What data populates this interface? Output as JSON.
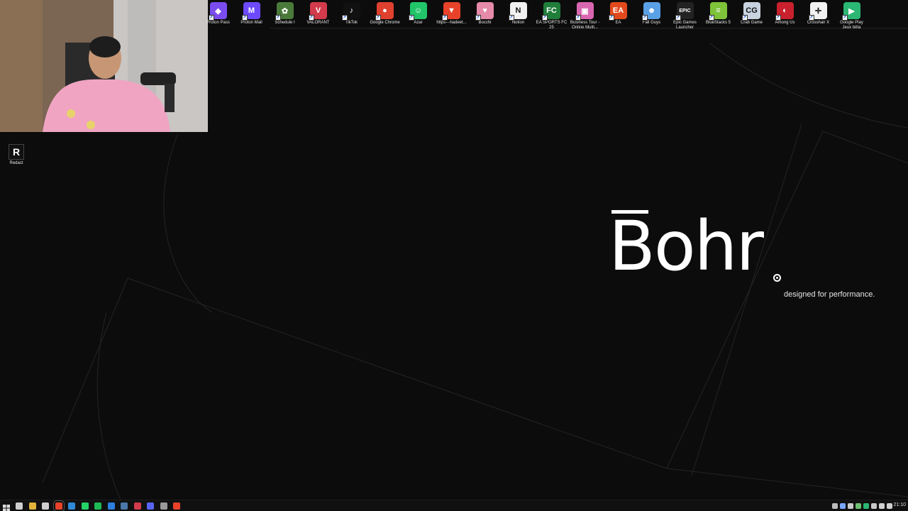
{
  "desktop_icons": [
    {
      "label": "Proton Pass",
      "icon": "proton-pass-icon",
      "color": "#7b4cf0",
      "glyph": "◆"
    },
    {
      "label": "Proton Mail",
      "icon": "proton-mail-icon",
      "color": "#6d4aff",
      "glyph": "M"
    },
    {
      "label": "Schedule I",
      "icon": "schedule-one-icon",
      "color": "#4a7a3a",
      "glyph": "✿"
    },
    {
      "label": "VALORANT",
      "icon": "valorant-icon",
      "color": "#d13b4b",
      "glyph": "V"
    },
    {
      "label": "TikTok",
      "icon": "tiktok-icon",
      "color": "#111111",
      "glyph": "♪"
    },
    {
      "label": "Google Chrome",
      "icon": "chrome-icon",
      "color": "#e0412f",
      "glyph": "●"
    },
    {
      "label": "Azar",
      "icon": "azar-icon",
      "color": "#22c46a",
      "glyph": "☺"
    },
    {
      "label": "https---hadeet...",
      "icon": "brave-icon",
      "color": "#e8432a",
      "glyph": "▼"
    },
    {
      "label": "Bocchi",
      "icon": "bocchi-icon",
      "color": "#e58aa8",
      "glyph": "♥"
    },
    {
      "label": "Notion",
      "icon": "notion-icon",
      "color": "#f2f2f2",
      "glyph": "N"
    },
    {
      "label": "EA SPORTS FC 25",
      "icon": "ea-fc-icon",
      "color": "#1f7d3a",
      "glyph": "FC"
    },
    {
      "label": "Business Tour - Online Multi...",
      "icon": "business-tour-icon",
      "color": "#d866b0",
      "glyph": "▣"
    },
    {
      "label": "EA",
      "icon": "ea-icon",
      "color": "#e24a1d",
      "glyph": "EA"
    },
    {
      "label": "Fall Guys",
      "icon": "fall-guys-icon",
      "color": "#5aa0e6",
      "glyph": "☻"
    },
    {
      "label": "Epic Games Launcher",
      "icon": "epic-games-icon",
      "color": "#222222",
      "glyph": "EPIC"
    },
    {
      "label": "BlueStacks 5",
      "icon": "bluestacks-icon",
      "color": "#7ec23a",
      "glyph": "≡"
    },
    {
      "label": "Crab Game",
      "icon": "crab-game-icon",
      "color": "#c9d3e0",
      "glyph": "CG"
    },
    {
      "label": "Among Us",
      "icon": "among-us-icon",
      "color": "#c8202c",
      "glyph": "◐"
    },
    {
      "label": "Crosshair X",
      "icon": "crosshair-x-icon",
      "color": "#f2f2f2",
      "glyph": "✛"
    },
    {
      "label": "Google Play Jeux bêta",
      "icon": "google-play-games-icon",
      "color": "#2bb673",
      "glyph": "▶"
    }
  ],
  "side_icon": {
    "label": "Redact",
    "glyph": "R"
  },
  "brand": {
    "word": "Bohr",
    "tagline": "designed for performance."
  },
  "taskbar": {
    "apps": [
      {
        "icon": "search-icon",
        "color": "#cfcfcf"
      },
      {
        "icon": "file-explorer-icon",
        "color": "#e2b33a"
      },
      {
        "icon": "task-view-icon",
        "color": "#cfcfcf"
      },
      {
        "icon": "brave-taskbar-icon",
        "color": "#e8432a"
      },
      {
        "icon": "edge-icon",
        "color": "#2f8ad8"
      },
      {
        "icon": "whatsapp-icon",
        "color": "#25d366"
      },
      {
        "icon": "spotify-icon",
        "color": "#1db954"
      },
      {
        "icon": "app-blue-icon",
        "color": "#2d7fe0"
      },
      {
        "icon": "steam-icon",
        "color": "#4a78a8"
      },
      {
        "icon": "valorant-taskbar-icon",
        "color": "#d13b4b"
      },
      {
        "icon": "discord-icon",
        "color": "#5865f2"
      },
      {
        "icon": "settings-icon",
        "color": "#9a9a9a"
      },
      {
        "icon": "record-icon",
        "color": "#e8432a"
      }
    ],
    "tray": [
      {
        "icon": "chevron-up-icon",
        "color": "#bdbdbd"
      },
      {
        "icon": "tray-app-icon",
        "color": "#7aa6ff"
      },
      {
        "icon": "tray-app-icon",
        "color": "#c9c9c9"
      },
      {
        "icon": "tray-app-icon",
        "color": "#6fbf73"
      },
      {
        "icon": "tray-app-icon",
        "color": "#2bb673"
      },
      {
        "icon": "tray-app-icon",
        "color": "#c9c9c9"
      },
      {
        "icon": "network-icon",
        "color": "#d0d0d0"
      },
      {
        "icon": "volume-icon",
        "color": "#d0d0d0"
      }
    ],
    "clock": "21:10"
  }
}
